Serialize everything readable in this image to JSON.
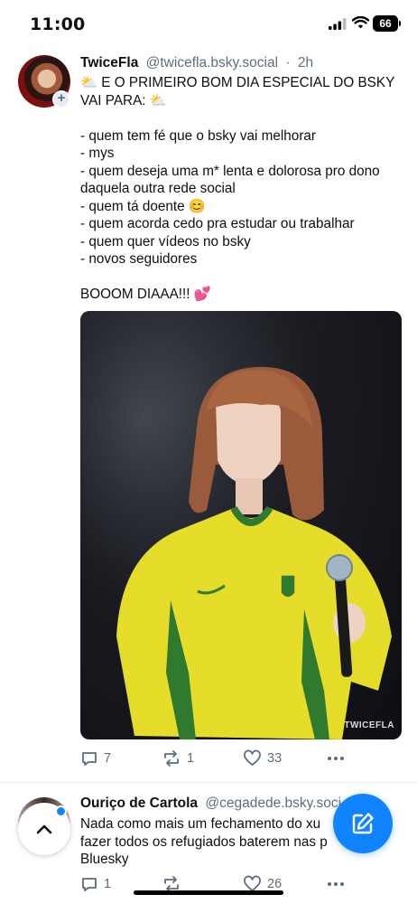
{
  "status_bar": {
    "time": "11:00",
    "battery": "66"
  },
  "post1": {
    "author_name": "TwiceFla",
    "handle": "@twicefla.bsky.social",
    "separator": "·",
    "age": "2h",
    "text": "⛅ E O PRIMEIRO BOM DIA ESPECIAL DO BSKY VAI PARA: ⛅\n\n- quem tem fé que o bsky vai melhorar\n- mys\n- quem deseja uma m* lenta e dolorosa pro dono daquela outra rede social\n- quem tá doente 😊\n- quem acorda cedo pra estudar ou trabalhar\n- quem quer vídeos no bsky\n- novos seguidores\n\nBOOOM DIAAA!!! 💕",
    "image_watermark": "TWICEFLA",
    "replies": "7",
    "reposts": "1",
    "likes": "33"
  },
  "post2": {
    "author_name": "Ouriço de Cartola",
    "handle": "@cegadede.bsky.soci",
    "text": "Nada como mais um fechamento do xu\nfazer todos os refugiados baterem nas p        do\nBluesky",
    "replies": "1",
    "reposts": "",
    "likes": "26"
  },
  "colors": {
    "accent": "#1083fe",
    "muted": "#5c6d7e"
  },
  "icons": [
    "signal-icon",
    "wifi-icon",
    "battery-icon",
    "reply-icon",
    "repost-icon",
    "like-icon",
    "more-icon",
    "compose-icon",
    "chevron-up-icon"
  ]
}
